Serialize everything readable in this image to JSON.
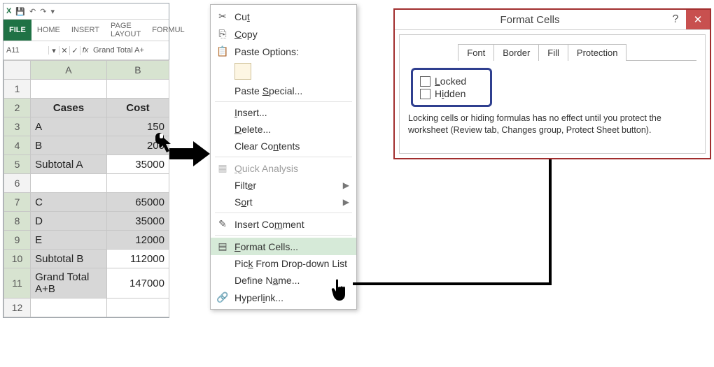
{
  "excel": {
    "ribbon": {
      "file": "FILE",
      "home": "HOME",
      "insert": "INSERT",
      "pagelayout": "PAGE LAYOUT",
      "formulas": "FORMUL"
    },
    "namebox": "A11",
    "fx": "fx",
    "formula": "Grand Total A+",
    "col_a": "A",
    "col_b": "B",
    "rows": [
      "1",
      "2",
      "3",
      "4",
      "5",
      "6",
      "7",
      "8",
      "9",
      "10",
      "11",
      "12"
    ],
    "header_cases": "Cases",
    "header_cost": "Cost",
    "r3a": "A",
    "r3b": "150",
    "r4a": "B",
    "r4b": "200",
    "r5a": "Subtotal A",
    "r5b": "35000",
    "r7a": "C",
    "r7b": "65000",
    "r8a": "D",
    "r8b": "35000",
    "r9a": "E",
    "r9b": "12000",
    "r10a": "Subtotal B",
    "r10b": "112000",
    "r11a": "Grand Total A+B",
    "r11b": "147000"
  },
  "context_menu": {
    "cut": "Cut",
    "copy": "Copy",
    "paste_options": "Paste Options:",
    "paste_special": "Paste Special...",
    "insert": "Insert...",
    "delete": "Delete...",
    "clear": "Clear Contents",
    "quick": "Quick Analysis",
    "filter": "Filter",
    "sort": "Sort",
    "comment": "Insert Comment",
    "format": "Format Cells...",
    "pick": "Pick From Drop-down List",
    "define": "Define Name...",
    "hyperlink": "Hyperlink..."
  },
  "dialog": {
    "title": "Format Cells",
    "help": "?",
    "close": "✕",
    "tabs": {
      "font": "Font",
      "border": "Border",
      "fill": "Fill",
      "protection": "Protection"
    },
    "locked": "Locked",
    "hidden": "Hidden",
    "note": "Locking cells or hiding formulas has no effect until you protect the worksheet (Review tab, Changes group, Protect Sheet button)."
  },
  "icons": {
    "excel": "X",
    "save": "💾",
    "undo": "↶",
    "redo": "↷",
    "dd": "▾",
    "cut": "✂",
    "copy": "⎘",
    "paste": "📋",
    "quick": "▦",
    "comment": "✎",
    "format": "▤",
    "link": "🔗",
    "submenu": "▶"
  }
}
